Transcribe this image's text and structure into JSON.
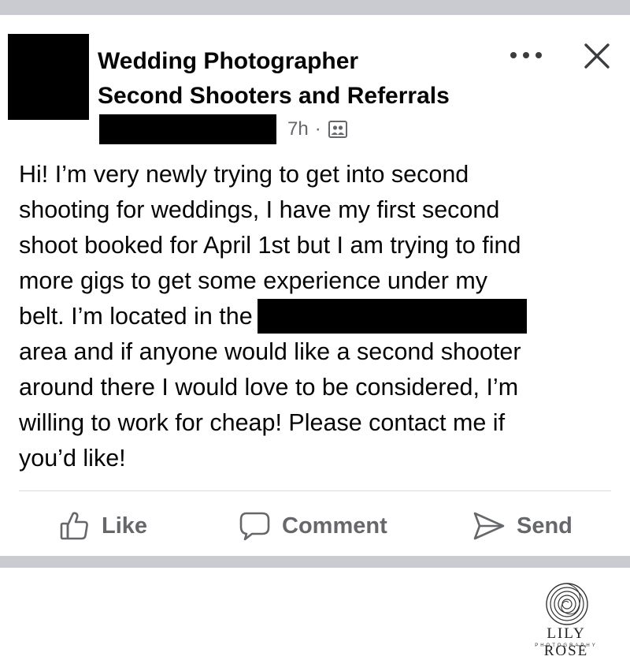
{
  "post": {
    "group_name_line1": "Wedding Photographer",
    "group_name_line2": "Second Shooters and Referrals",
    "time": "7h",
    "separator": "·",
    "group_icon": "group-icon",
    "menu_icon": "more-horizontal-icon",
    "close_icon": "close-icon",
    "body_lines": [
      "Hi! I’m very newly trying to get into second",
      "shooting for weddings, I have my first second",
      "shoot booked for April 1st but I am trying to find",
      "more gigs to get some experience under my",
      "belt. I’m located in the",
      "area and if anyone would like a second shooter",
      "around there I would love to be considered, I’m",
      "willing to work for cheap! Please contact me if",
      "you’d like!"
    ]
  },
  "actions": {
    "like_label": "Like",
    "comment_label": "Comment",
    "send_label": "Send",
    "like_icon": "thumbs-up-icon",
    "comment_icon": "comment-bubble-icon",
    "send_icon": "send-arrow-icon"
  },
  "watermark": {
    "name": "LILY ROSE",
    "subtitle": "PHOTOGRAPHY",
    "logo_icon": "spiral-logo-icon"
  },
  "colors": {
    "text_primary": "#050505",
    "text_secondary": "#65676b",
    "separator_bar": "#c9cbd0",
    "redaction": "#000000"
  }
}
